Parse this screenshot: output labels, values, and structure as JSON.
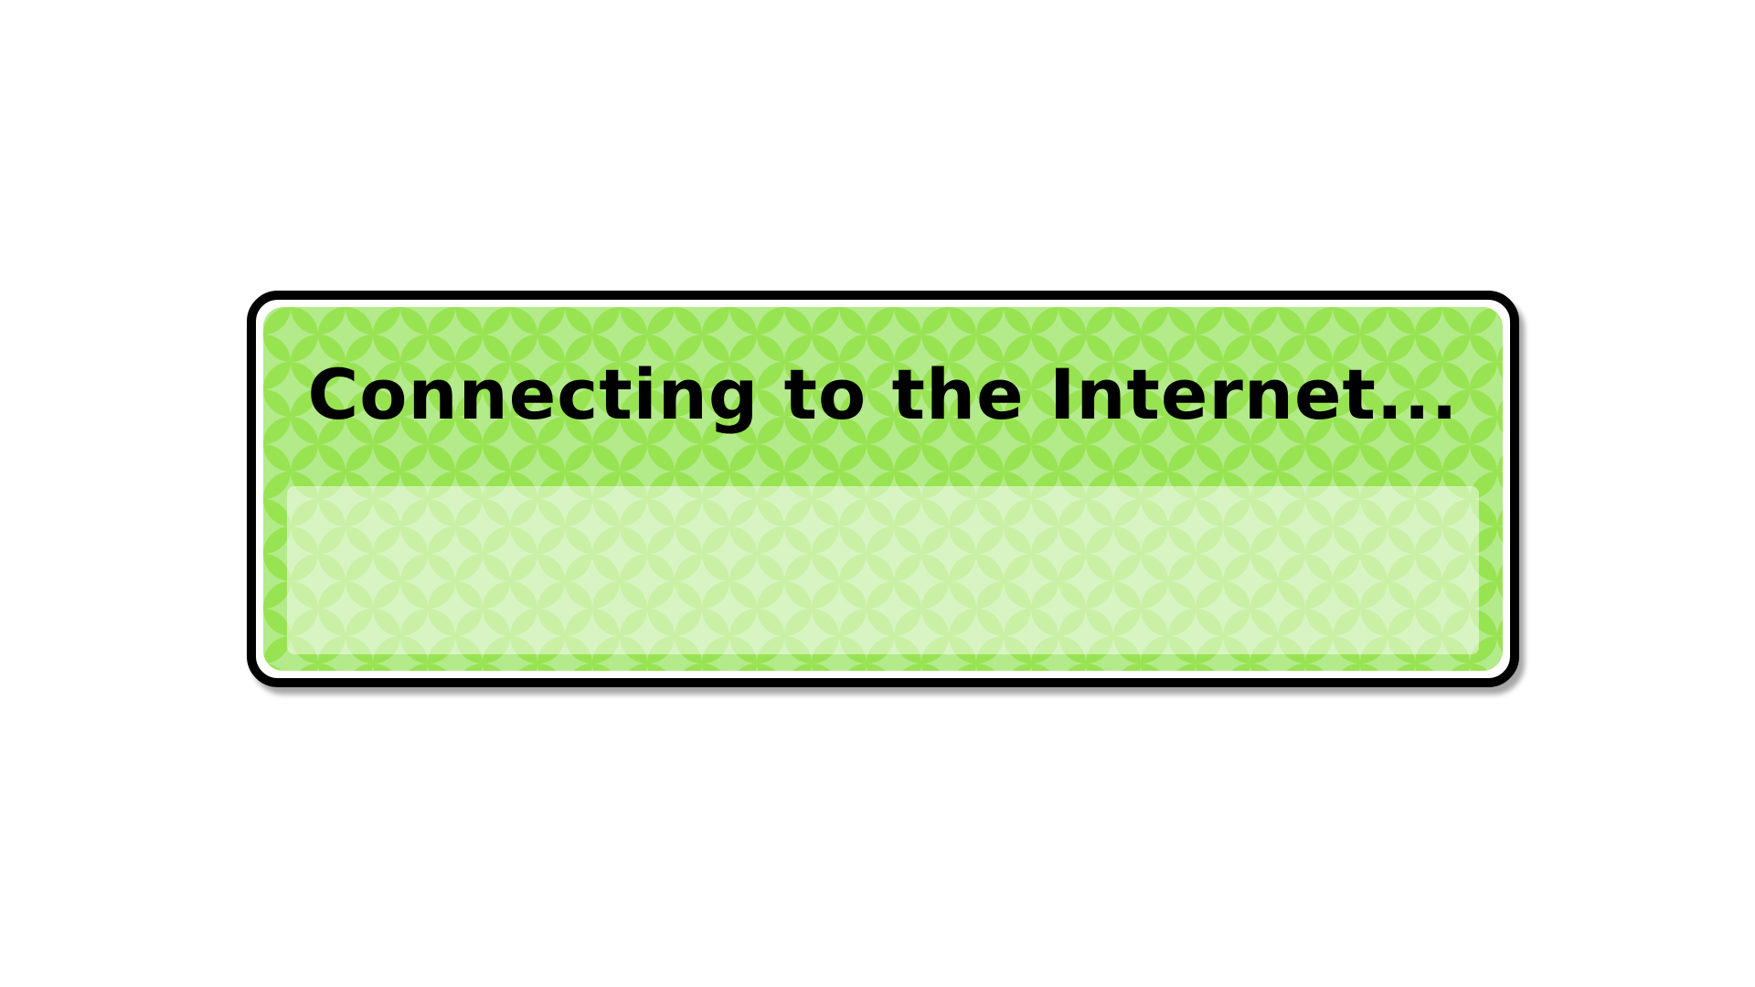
{
  "dialog": {
    "title": "Connecting to the Internet...",
    "message": ""
  },
  "colors": {
    "panel_light": "#b3ea8a",
    "panel_dark": "#98e352",
    "frame": "#000000",
    "background": "#ffffff"
  }
}
